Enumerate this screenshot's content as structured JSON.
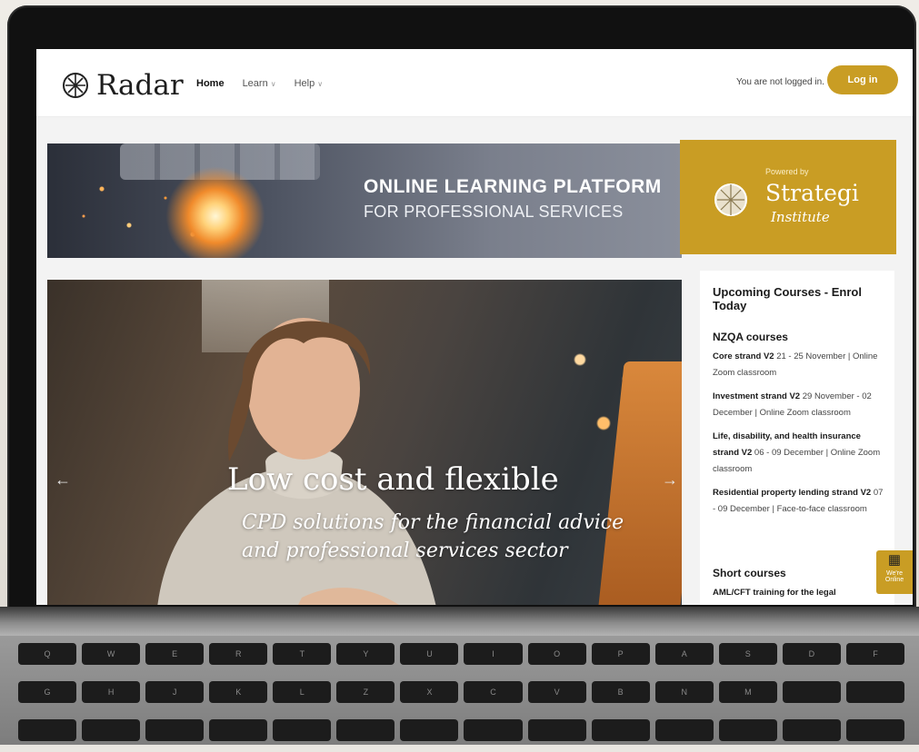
{
  "header": {
    "logo_text": "Radar",
    "nav": [
      {
        "label": "Home"
      },
      {
        "label": "Learn"
      },
      {
        "label": "Help"
      }
    ],
    "status_text": "You are not logged in.",
    "login_label": "Log in"
  },
  "banner": {
    "title": "ONLINE LEARNING PLATFORM",
    "subtitle": "FOR PROFESSIONAL SERVICES",
    "powered_by": "Powered by",
    "partner_name": "Strategi",
    "partner_sub": "Institute"
  },
  "hero": {
    "title": "Low cost and flexible",
    "subtitle": "CPD solutions for the financial advice and professional services sector"
  },
  "sidebar": {
    "heading": "Upcoming Courses - Enrol Today",
    "nzqa_heading": "NZQA courses",
    "courses": [
      {
        "name": "Core strand V2",
        "detail": " 21 - 25 November | Online Zoom classroom"
      },
      {
        "name": "Investment strand V2",
        "detail": " 29 November - 02 December | Online Zoom classroom"
      },
      {
        "name": "Life, disability, and health insurance strand V2",
        "detail": " 06 - 09 December | Online Zoom classroom"
      },
      {
        "name": "Residential property lending strand V2",
        "detail": " 07 - 09 December | Face-to-face classroom"
      }
    ],
    "short_heading": "Short courses",
    "short_first": "AML/CFT training for the legal"
  },
  "chat": {
    "label": "We're Online"
  },
  "keyboard": [
    "Q",
    "W",
    "E",
    "R",
    "T",
    "Y",
    "U",
    "I",
    "O",
    "P",
    "A",
    "S",
    "D",
    "F",
    "G",
    "H",
    "J",
    "K",
    "L",
    "Z",
    "X",
    "C",
    "V",
    "B",
    "N",
    "M"
  ],
  "colors": {
    "accent": "#c99d24",
    "text": "#1b1b1b"
  }
}
